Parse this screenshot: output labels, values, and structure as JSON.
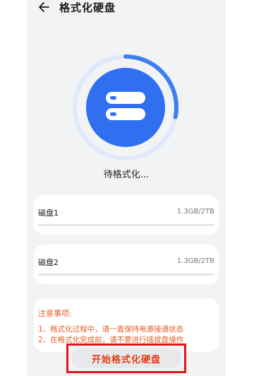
{
  "header": {
    "title": "格式化硬盘",
    "back_icon": "back-arrow-icon"
  },
  "progress": {
    "status_text": "待格式化...",
    "fraction": 0.28,
    "accent": "#3e7ef0",
    "track": "#dfe9fb",
    "icon": "hard-drive-icon"
  },
  "disks": [
    {
      "name": "磁盘1",
      "capacity": "1.3GB/2TB",
      "used_fraction": 0.0007
    },
    {
      "name": "磁盘2",
      "capacity": "1.3GB/2TB",
      "used_fraction": 0.0007
    }
  ],
  "notice": {
    "title": "注意事项:",
    "lines": [
      "1、格式化过程中，请一直保持电源接通状态",
      "2、在格式化完成前，请不要进行插拔盘操作"
    ],
    "color": "#e85d26"
  },
  "action": {
    "label": "开始格式化硬盘",
    "color": "#e63b14"
  }
}
